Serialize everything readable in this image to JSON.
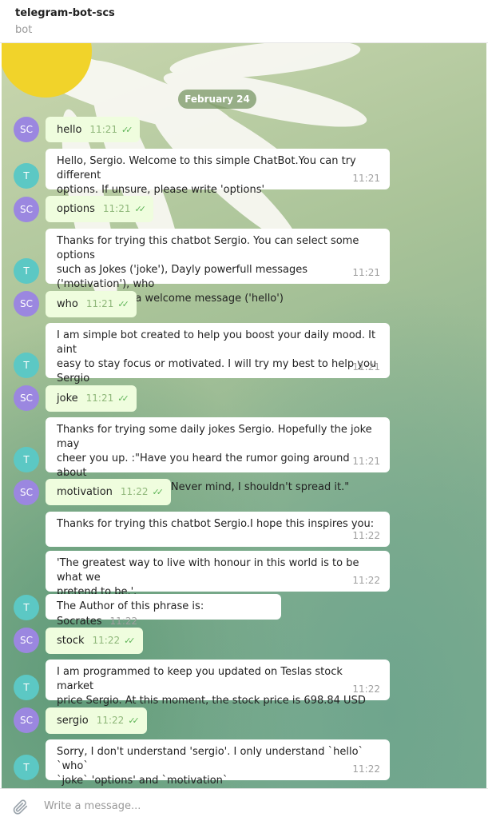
{
  "header": {
    "title": "telegram-bot-scs",
    "subtitle": "bot"
  },
  "date_separator": "February 24",
  "avatars": {
    "user": "SC",
    "bot": "T"
  },
  "messages": [
    {
      "from": "user",
      "text": "hello",
      "time": "11:21"
    },
    {
      "from": "bot",
      "lines": [
        "Hello, Sergio. Welcome to this simple ChatBot.You can try different",
        "options. If unsure, please write 'options'"
      ],
      "time": "11:21"
    },
    {
      "from": "user",
      "text": "options",
      "time": "11:21"
    },
    {
      "from": "bot",
      "lines": [
        "Thanks for trying this chatbot Sergio. You can select some options",
        "such as Jokes ('joke'), Dayly powerfull messages ('motivation'), who",
        "am I ('who') or a welcome message ('hello')"
      ],
      "time": "11:21"
    },
    {
      "from": "user",
      "text": "who",
      "time": "11:21"
    },
    {
      "from": "bot",
      "lines": [
        "I am simple bot created to help you boost your daily mood. It aint",
        "easy to stay focus or motivated. I will try my best to help you",
        "Sergio"
      ],
      "time": "11:21"
    },
    {
      "from": "user",
      "text": "joke",
      "time": "11:21"
    },
    {
      "from": "bot",
      "lines": [
        "Thanks for trying some daily jokes Sergio. Hopefully the joke may",
        "cheer you up. :\"Have you heard the rumor going around about",
        "butter?\",\"punchline\":\"Never mind, I shouldn't spread it.\""
      ],
      "time": "11:21"
    },
    {
      "from": "user",
      "text": "motivation",
      "time": "11:22"
    },
    {
      "from": "bot",
      "lines": [
        "Thanks for trying this chatbot Sergio.I hope this inspires you:"
      ],
      "time": "11:22"
    },
    {
      "from": "bot",
      "lines": [
        "'The greatest way to live with honour in this world is to be what we",
        "pretend to be.'."
      ],
      "time": "11:22"
    },
    {
      "from": "bot",
      "text": "The Author of this phrase is: Socrates",
      "time": "11:22"
    },
    {
      "from": "user",
      "text": "stock",
      "time": "11:22"
    },
    {
      "from": "bot",
      "lines": [
        "I am programmed to keep you updated on Teslas stock market",
        "price Sergio. At this moment, the stock price is  698.84 USD"
      ],
      "time": "11:22"
    },
    {
      "from": "user",
      "text": "sergio",
      "time": "11:22"
    },
    {
      "from": "bot",
      "lines": [
        "Sorry, I don't understand 'sergio'. I only understand `hello` `who`",
        "`joke` 'options' and `motivation`"
      ],
      "time": "11:22"
    }
  ],
  "composer": {
    "placeholder": "Write a message..."
  },
  "icons": {
    "attach": "paperclip-icon",
    "read": "double-check-icon"
  },
  "colors": {
    "outgoing": "#effdde",
    "incoming": "#ffffff",
    "user_avatar": "#9b87e0",
    "bot_avatar": "#5cc8c4",
    "ticks": "#5fb458"
  }
}
